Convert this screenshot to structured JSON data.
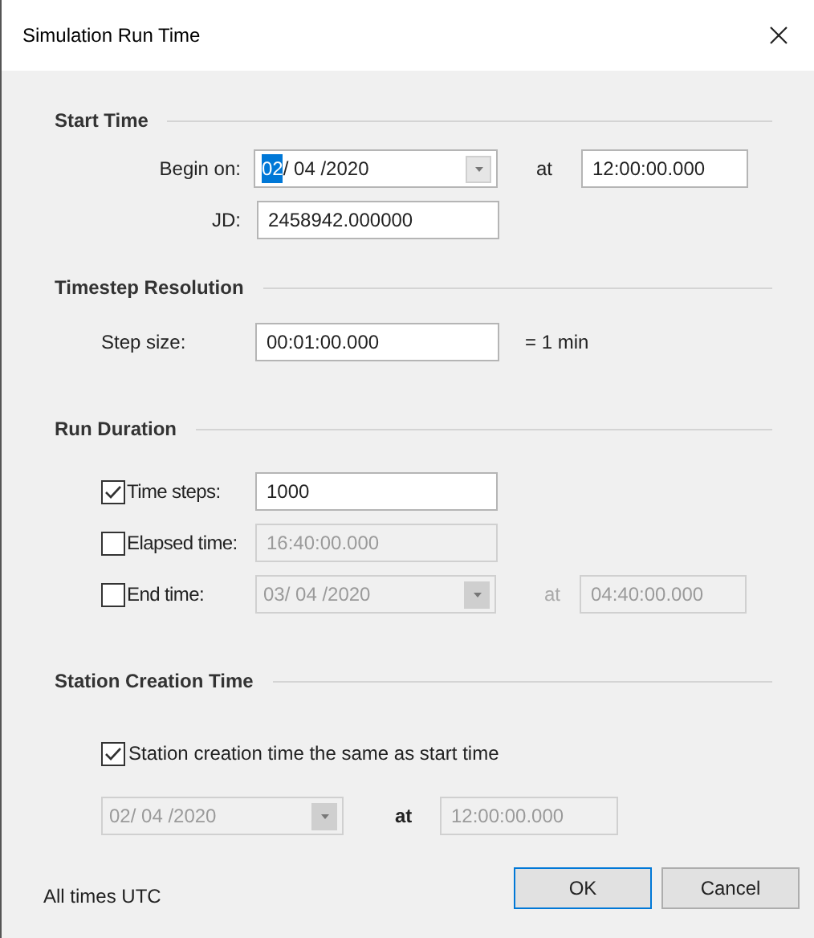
{
  "window": {
    "title": "Simulation Run Time"
  },
  "start_time": {
    "heading": "Start Time",
    "begin_label": "Begin on:",
    "date_segments": [
      {
        "text": "02",
        "selected": true
      },
      {
        "text": "/ 04 /2020",
        "selected": false
      }
    ],
    "at": "at",
    "time": "12:00:00.000",
    "jd_label": "JD:",
    "jd": "2458942.000000"
  },
  "timestep": {
    "heading": "Timestep Resolution",
    "label": "Step size:",
    "value": "00:01:00.000",
    "note": "= 1 min"
  },
  "run_duration": {
    "heading": "Run Duration",
    "rows": [
      {
        "kind": "field",
        "label": "Time steps:",
        "checked": true,
        "value": "1000",
        "disabled": false
      },
      {
        "kind": "field",
        "label": "Elapsed time:",
        "checked": false,
        "value": "16:40:00.000",
        "disabled": true
      },
      {
        "kind": "date_time",
        "label": "End time:",
        "checked": false,
        "value": "03/ 04 /2020",
        "at": "at",
        "time": "04:40:00.000",
        "disabled": true
      }
    ]
  },
  "station": {
    "heading": "Station Creation Time",
    "checkbox": {
      "label": "Station creation time the same as start time",
      "checked": true
    },
    "date": "02/ 04 /2020",
    "at": "at",
    "time": "12:00:00.000",
    "disabled": true
  },
  "footer": {
    "note": "All times UTC",
    "buttons": [
      {
        "label": "OK",
        "default": true
      },
      {
        "label": "Cancel",
        "default": false
      }
    ]
  }
}
